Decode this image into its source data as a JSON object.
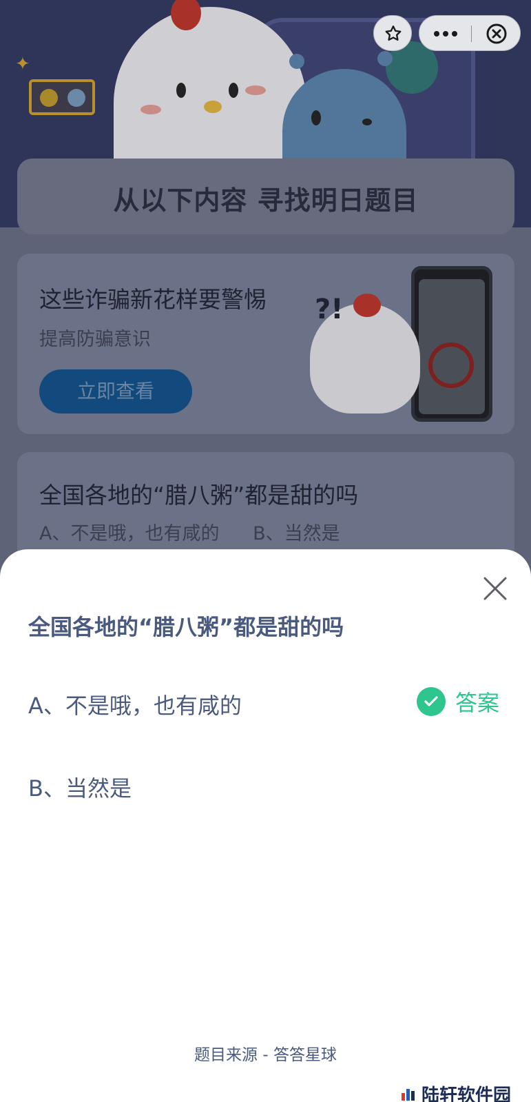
{
  "background": {
    "banner_title": "从以下内容  寻找明日题目",
    "promo": {
      "title": "这些诈骗新花样要警惕",
      "subtitle": "提高防骗意识",
      "button_label": "立即查看"
    },
    "question_card": {
      "title": "全国各地的“腊八粥”都是甜的吗",
      "option_a": "A、不是哦，也有咸的",
      "option_b": "B、当然是"
    }
  },
  "capsule": {
    "star_icon": "star-icon",
    "more_icon": "more-icon",
    "close_icon": "close-circle-icon"
  },
  "sheet": {
    "title": "全国各地的“腊八粥”都是甜的吗",
    "options": [
      {
        "label": "A、不是哦，也有咸的",
        "correct": true
      },
      {
        "label": "B、当然是",
        "correct": false
      }
    ],
    "answer_label": "答案",
    "source": "题目来源 - 答答星球"
  },
  "watermark": {
    "text": "陆轩软件园"
  },
  "colors": {
    "answer_green": "#2ec68d",
    "sheet_text": "#4a5a7e"
  }
}
